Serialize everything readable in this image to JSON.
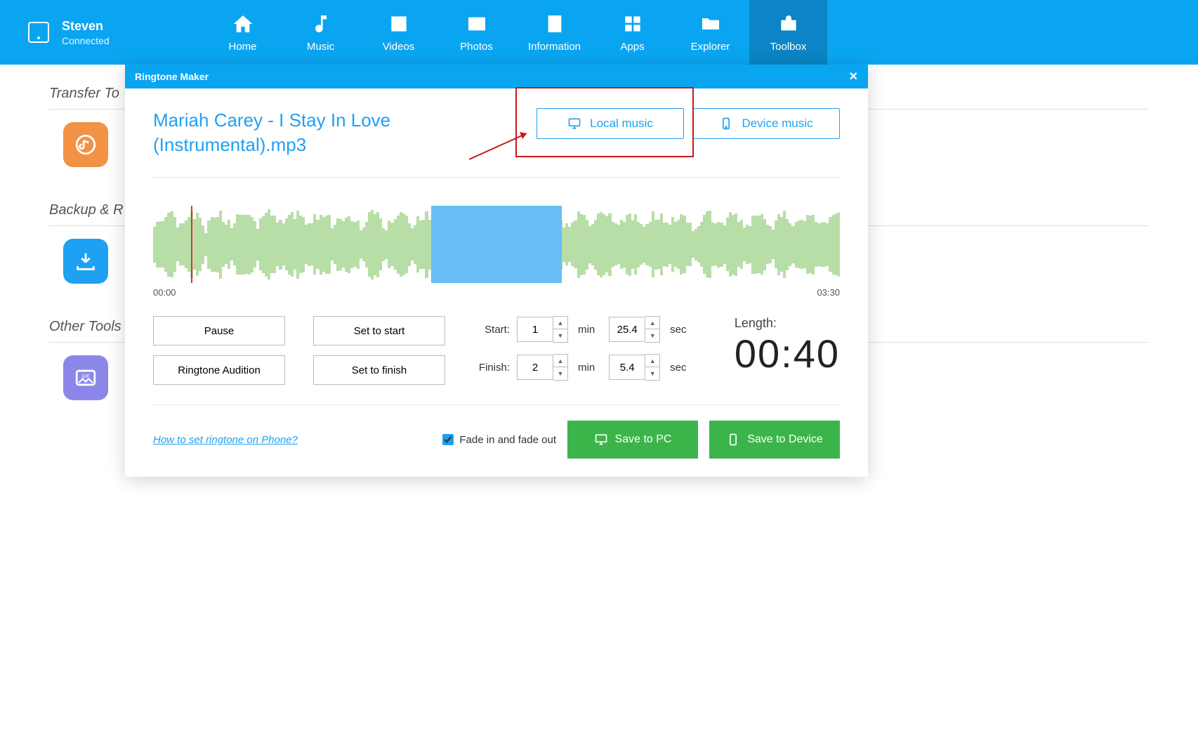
{
  "device": {
    "name": "Steven",
    "status": "Connected"
  },
  "nav": [
    {
      "label": "Home"
    },
    {
      "label": "Music"
    },
    {
      "label": "Videos"
    },
    {
      "label": "Photos"
    },
    {
      "label": "Information"
    },
    {
      "label": "Apps"
    },
    {
      "label": "Explorer"
    },
    {
      "label": "Toolbox",
      "active": true
    }
  ],
  "sections": {
    "transfer": "Transfer To",
    "backup": "Backup & R",
    "other": "Other Tools"
  },
  "modal": {
    "title": "Ringtone Maker",
    "filename": "Mariah Carey - I Stay In Love (Instrumental).mp3",
    "local_music": "Local music",
    "device_music": "Device music",
    "time_start_label": "00:00",
    "time_end_label": "03:30",
    "btn_pause": "Pause",
    "btn_set_start": "Set to start",
    "btn_ringtone_audition": "Ringtone Audition",
    "btn_set_finish": "Set to finish",
    "start_label": "Start:",
    "finish_label": "Finish:",
    "start_min": "1",
    "start_sec": "25.4",
    "finish_min": "2",
    "finish_sec": "5.4",
    "unit_min": "min",
    "unit_sec": "sec",
    "length_label": "Length:",
    "length_value": "00:40",
    "howto": "How to set ringtone on Phone?",
    "fade_label": "Fade in and fade out",
    "fade_checked": true,
    "save_pc": "Save to PC",
    "save_device": "Save to Device",
    "selection": {
      "start_pct": 40.5,
      "end_pct": 59.5
    },
    "playhead_pct": 5.5
  }
}
